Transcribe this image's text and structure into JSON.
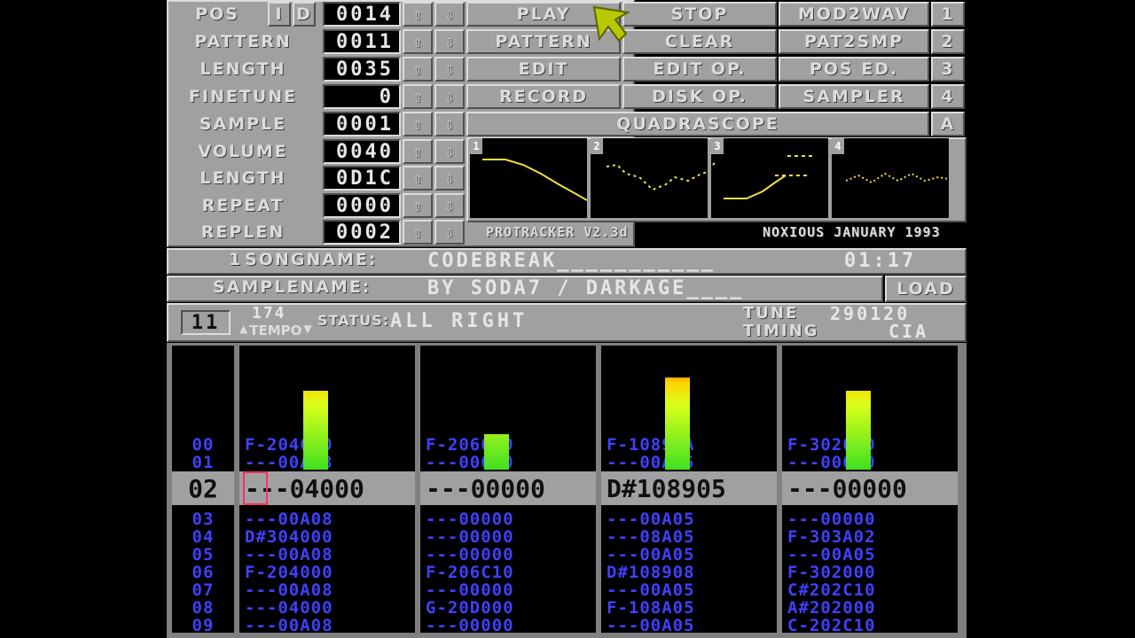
{
  "app": "ProTracker",
  "left_params": [
    {
      "label": "POS",
      "value": "0014"
    },
    {
      "label": "PATTERN",
      "value": "0011"
    },
    {
      "label": "LENGTH",
      "value": "0035"
    },
    {
      "label": "FINETUNE",
      "value": "0"
    },
    {
      "label": "SAMPLE",
      "value": "0001"
    },
    {
      "label": "VOLUME",
      "value": "0040"
    },
    {
      "label": "LENGTH",
      "value": "0D1C"
    },
    {
      "label": "REPEAT",
      "value": "0000"
    },
    {
      "label": "REPLEN",
      "value": "0002"
    }
  ],
  "pos_flags": {
    "i": "I",
    "d": "D"
  },
  "buttons": {
    "play": "PLAY",
    "stop": "STOP",
    "mod2wav": "MOD2WAV",
    "n1": "1",
    "pattern": "PATTERN",
    "clear": "CLEAR",
    "pat2smp": "PAT2SMP",
    "n2": "2",
    "edit": "EDIT",
    "edit_op": "EDIT OP.",
    "pos_ed": "POS ED.",
    "n3": "3",
    "record": "RECORD",
    "disk_op": "DISK OP.",
    "sampler": "SAMPLER",
    "n4": "4",
    "quadrascope": "QUADRASCOPE",
    "scope_mode": "A",
    "load": "LOAD"
  },
  "scope_labels": [
    "1",
    "2",
    "3",
    "4"
  ],
  "version": "PROTRACKER V2.3d",
  "credit": "NOXIOUS JANUARY 1993",
  "song": {
    "number": "1",
    "label": "SONGNAME:",
    "name": "CODEBREAK___________",
    "time": "01:17"
  },
  "sample": {
    "label": "SAMPLENAME:",
    "name": "BY SODA7 / DARKAGE____"
  },
  "status": {
    "octave": "11",
    "tempo_value": "174",
    "tempo_label": "TEMPO",
    "status_label": "STATUS:",
    "status_text": "ALL RIGHT",
    "tune_label": "TUNE",
    "tune_value": "290120",
    "timing_label": "TIMING",
    "timing_value": "CIA"
  },
  "vu_levels": [
    0.74,
    0.33,
    0.87,
    0.74
  ],
  "rows": {
    "numbers": [
      "00",
      "01",
      "02",
      "03",
      "04",
      "05",
      "06",
      "07",
      "08",
      "09"
    ],
    "current": "02",
    "ch1": [
      "F-204000",
      "---00A08",
      "---04000",
      "---00A08",
      "D#304000",
      "---00A08",
      "F-204000",
      "---00A08",
      "---04000",
      "---00A08"
    ],
    "ch2": [
      "F-206000",
      "---00000",
      "---00000",
      "---00000",
      "---00000",
      "---00000",
      "F-206C10",
      "---00000",
      "G-20D000",
      "---00000"
    ],
    "ch3": [
      "F-10891A",
      "---00A05",
      "D#108905",
      "---00A05",
      "---08A05",
      "---00A05",
      "D#108908",
      "---00A05",
      "F-108A05",
      "---00A05"
    ],
    "ch4": [
      "F-302000",
      "---00000",
      "---00000",
      "---00000",
      "F-303A02",
      "---00A05",
      "F-302000",
      "C#202C10",
      "A#202000",
      "C-202C10"
    ]
  }
}
